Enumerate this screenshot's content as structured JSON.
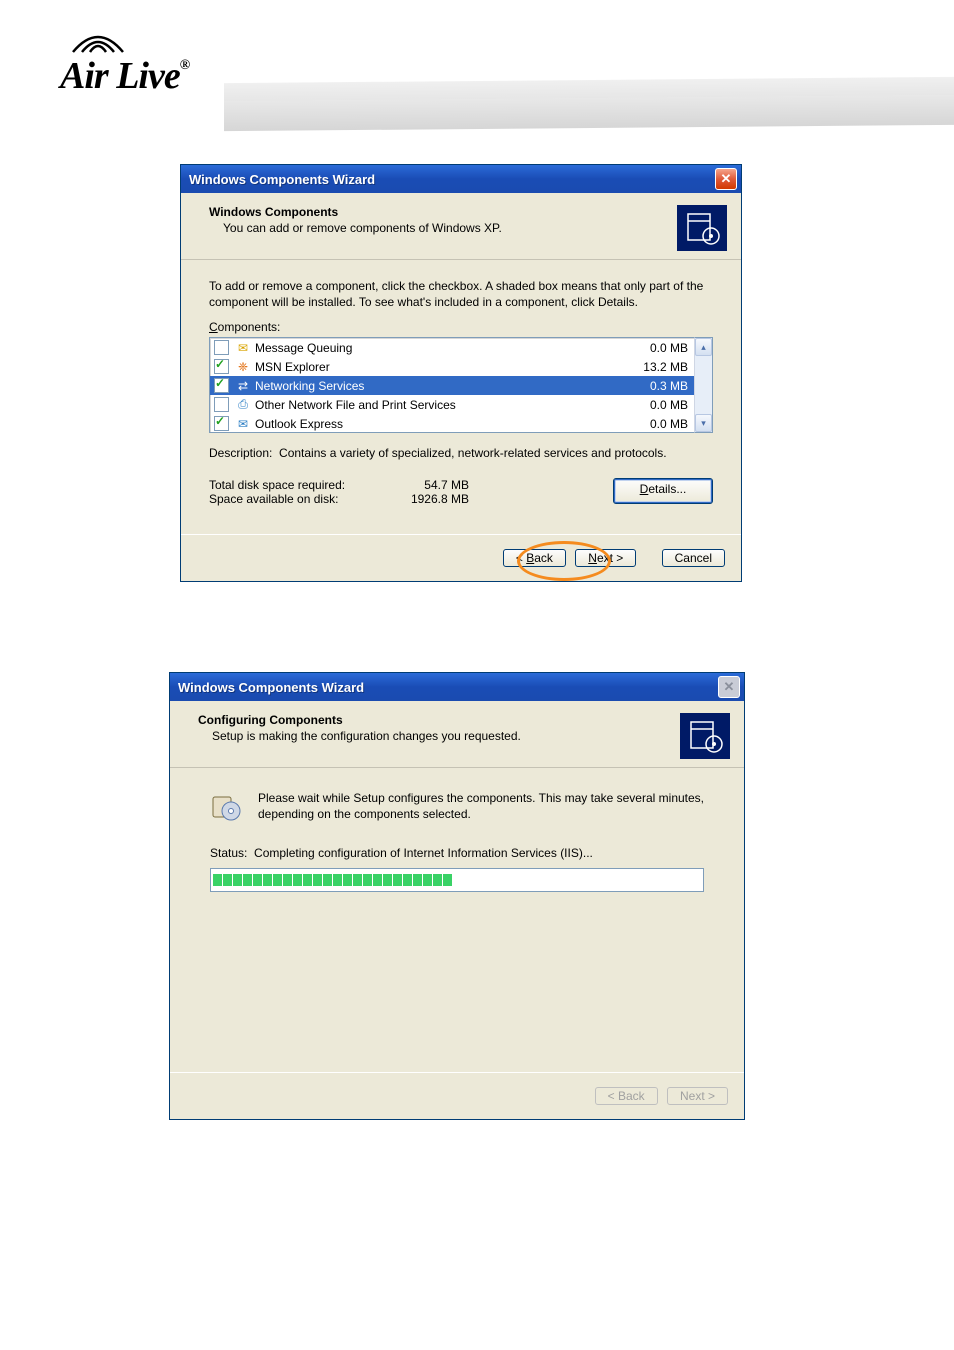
{
  "logo_text": "Air Live",
  "dialog1": {
    "title": "Windows Components Wizard",
    "header_title": "Windows Components",
    "header_sub": "You can add or remove components of Windows XP.",
    "instruction": "To add or remove a component, click the checkbox.  A shaded box means that only part of the component will be installed.  To see what's included in a component, click Details.",
    "components_label": "Components:",
    "rows": [
      {
        "checked": false,
        "selected": false,
        "icon": "envelope-gears-icon",
        "label": "Message Queuing",
        "size": "0.0 MB"
      },
      {
        "checked": true,
        "selected": false,
        "icon": "butterfly-icon",
        "label": "MSN Explorer",
        "size": "13.2 MB"
      },
      {
        "checked": true,
        "selected": true,
        "icon": "network-icon",
        "label": "Networking Services",
        "size": "0.3 MB"
      },
      {
        "checked": false,
        "selected": false,
        "icon": "print-net-icon",
        "label": "Other Network File and Print Services",
        "size": "0.0 MB"
      },
      {
        "checked": true,
        "selected": false,
        "icon": "outlook-icon",
        "label": "Outlook Express",
        "size": "0.0 MB"
      }
    ],
    "description_label": "Description:",
    "description_text": "Contains a variety of specialized, network-related services and protocols.",
    "total_req_label": "Total disk space required:",
    "total_req_value": "54.7 MB",
    "avail_label": "Space available on disk:",
    "avail_value": "1926.8 MB",
    "details_btn": "Details...",
    "back_btn": "< Back",
    "next_btn": "Next >",
    "cancel_btn": "Cancel"
  },
  "dialog2": {
    "title": "Windows Components Wizard",
    "header_title": "Configuring Components",
    "header_sub": "Setup is making the configuration changes you requested.",
    "wait_text": "Please wait while Setup configures the components. This may take several minutes, depending on the components selected.",
    "status_label": "Status:",
    "status_text": "Completing configuration of Internet Information Services (IIS)...",
    "progress_blocks": 24,
    "back_btn": "< Back",
    "next_btn": "Next >"
  }
}
